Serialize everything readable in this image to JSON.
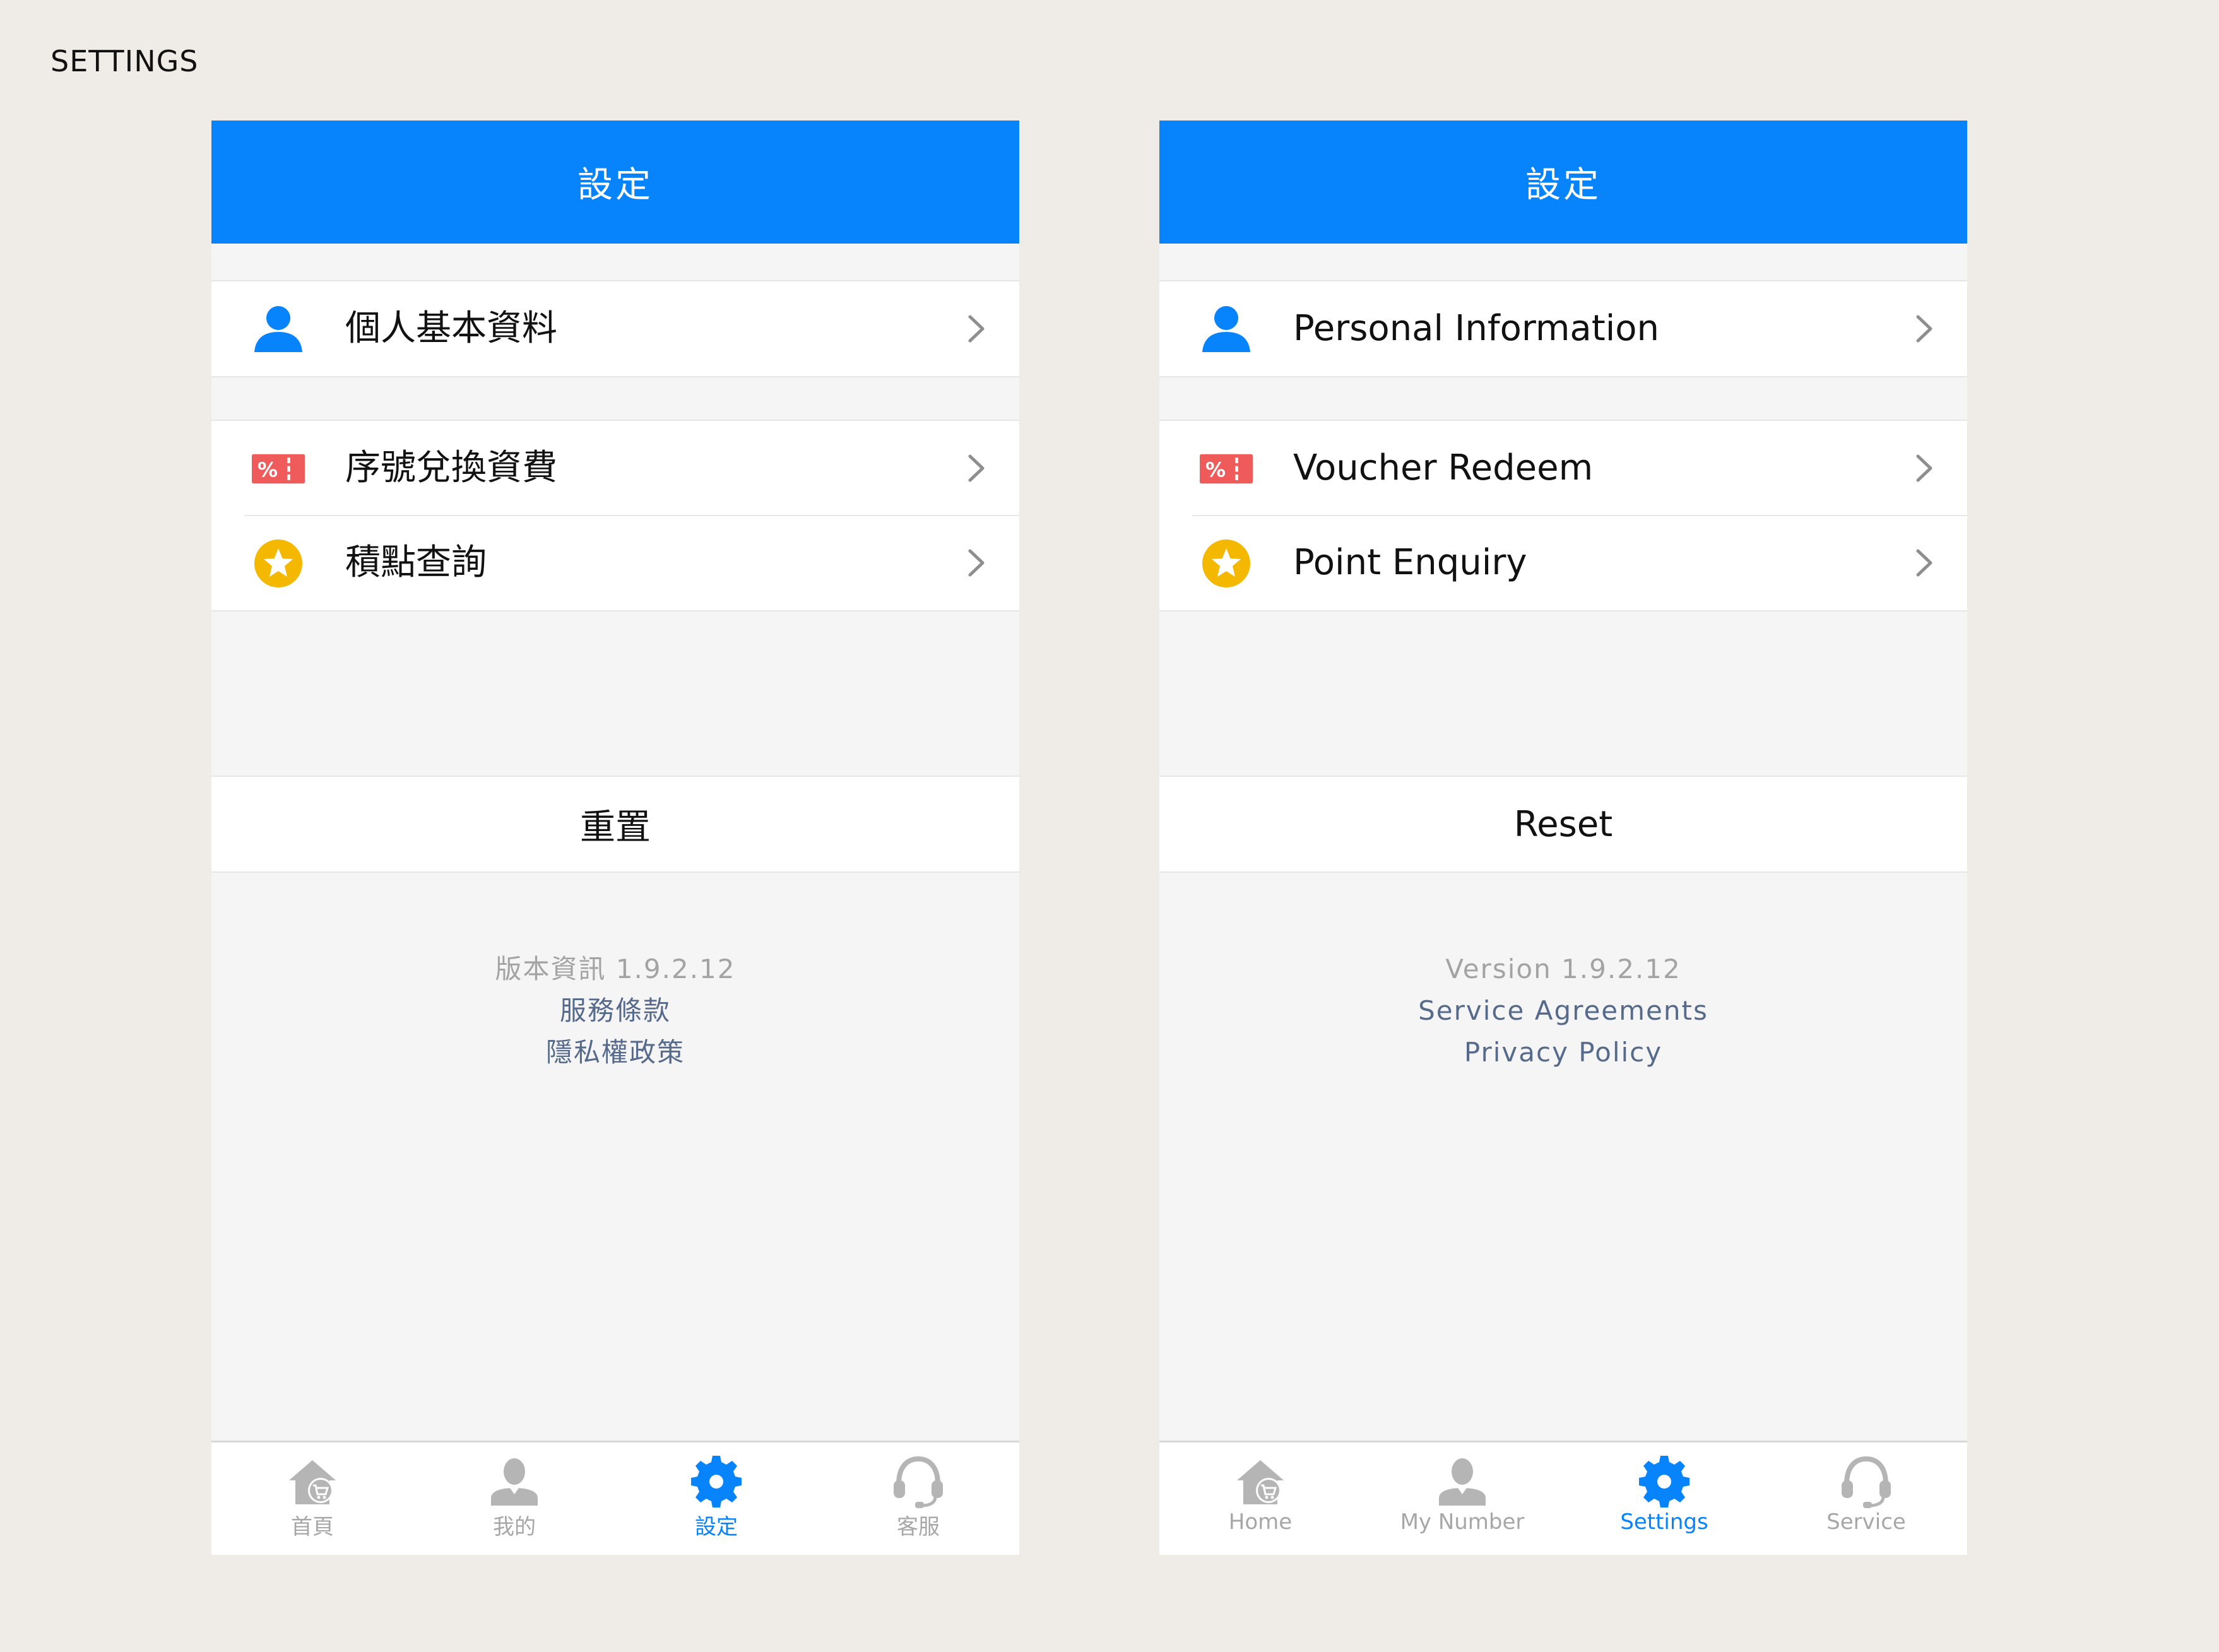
{
  "page_label": "SETTINGS",
  "colors": {
    "accent": "#0784fc",
    "tab_inactive": "#a7a7a7",
    "voucher_red": "#ef5a5a",
    "star_yellow": "#f5b800",
    "link": "#566a8c"
  },
  "screens": {
    "zh": {
      "title": "設定",
      "personal_info": "個人基本資料",
      "voucher_redeem": "序號兌換資費",
      "point_enquiry": "積點查詢",
      "reset": "重置",
      "version": "版本資訊 1.9.2.12",
      "service_agreements": "服務條款",
      "privacy_policy": "隱私權政策",
      "tabs": [
        {
          "label": "首頁",
          "icon": "home-cart-icon",
          "active": false
        },
        {
          "label": "我的",
          "icon": "user-icon",
          "active": false
        },
        {
          "label": "設定",
          "icon": "gear-icon",
          "active": true
        },
        {
          "label": "客服",
          "icon": "headset-icon",
          "active": false
        }
      ]
    },
    "en": {
      "title": "設定",
      "personal_info": "Personal Information",
      "voucher_redeem": "Voucher Redeem",
      "point_enquiry": "Point Enquiry",
      "reset": "Reset",
      "version": "Version 1.9.2.12",
      "service_agreements": "Service Agreements",
      "privacy_policy": "Privacy Policy",
      "tabs": [
        {
          "label": "Home",
          "icon": "home-cart-icon",
          "active": false
        },
        {
          "label": "My Number",
          "icon": "user-icon",
          "active": false
        },
        {
          "label": "Settings",
          "icon": "gear-icon",
          "active": true
        },
        {
          "label": "Service",
          "icon": "headset-icon",
          "active": false
        }
      ]
    }
  }
}
